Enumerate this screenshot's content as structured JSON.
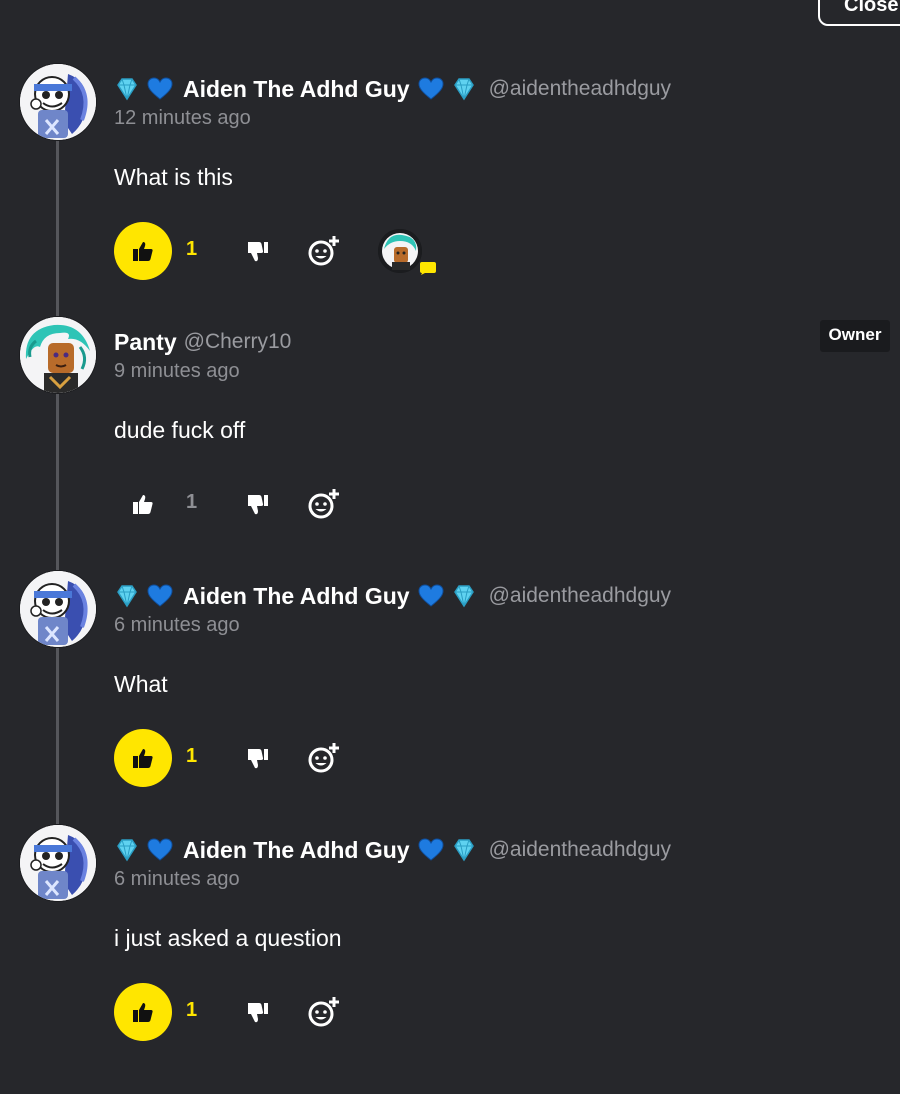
{
  "header": {
    "close_label": "Close"
  },
  "comments": [
    {
      "display_name": "Aiden The Adhd Guy",
      "username": "@aidentheadhdguy",
      "time": "12 minutes ago",
      "text": "What is this",
      "likes": "1",
      "liked": true,
      "has_reactor": true,
      "badges": [
        "gem-icon",
        "blue-heart-icon",
        "blue-heart-icon",
        "gem-icon"
      ]
    },
    {
      "display_name": "Panty",
      "username": "@Cherry10",
      "time": "9 minutes ago",
      "text": "dude fuck off",
      "likes": "1",
      "liked": false,
      "role_badge": "Owner"
    },
    {
      "display_name": "Aiden The Adhd Guy",
      "username": "@aidentheadhdguy",
      "time": "6 minutes ago",
      "text": "What",
      "likes": "1",
      "liked": true,
      "badges": [
        "gem-icon",
        "blue-heart-icon",
        "blue-heart-icon",
        "gem-icon"
      ]
    },
    {
      "display_name": "Aiden The Adhd Guy",
      "username": "@aidentheadhdguy",
      "time": "6 minutes ago",
      "text": "i just asked a question",
      "likes": "1",
      "liked": true,
      "badges": [
        "gem-icon",
        "blue-heart-icon",
        "blue-heart-icon",
        "gem-icon"
      ]
    }
  ],
  "colors": {
    "background": "#26272b",
    "like_active": "#ffe600",
    "muted_text": "#8e8f94",
    "heart_blue": "#1e7be0",
    "gem_cyan": "#5fd2f0"
  }
}
